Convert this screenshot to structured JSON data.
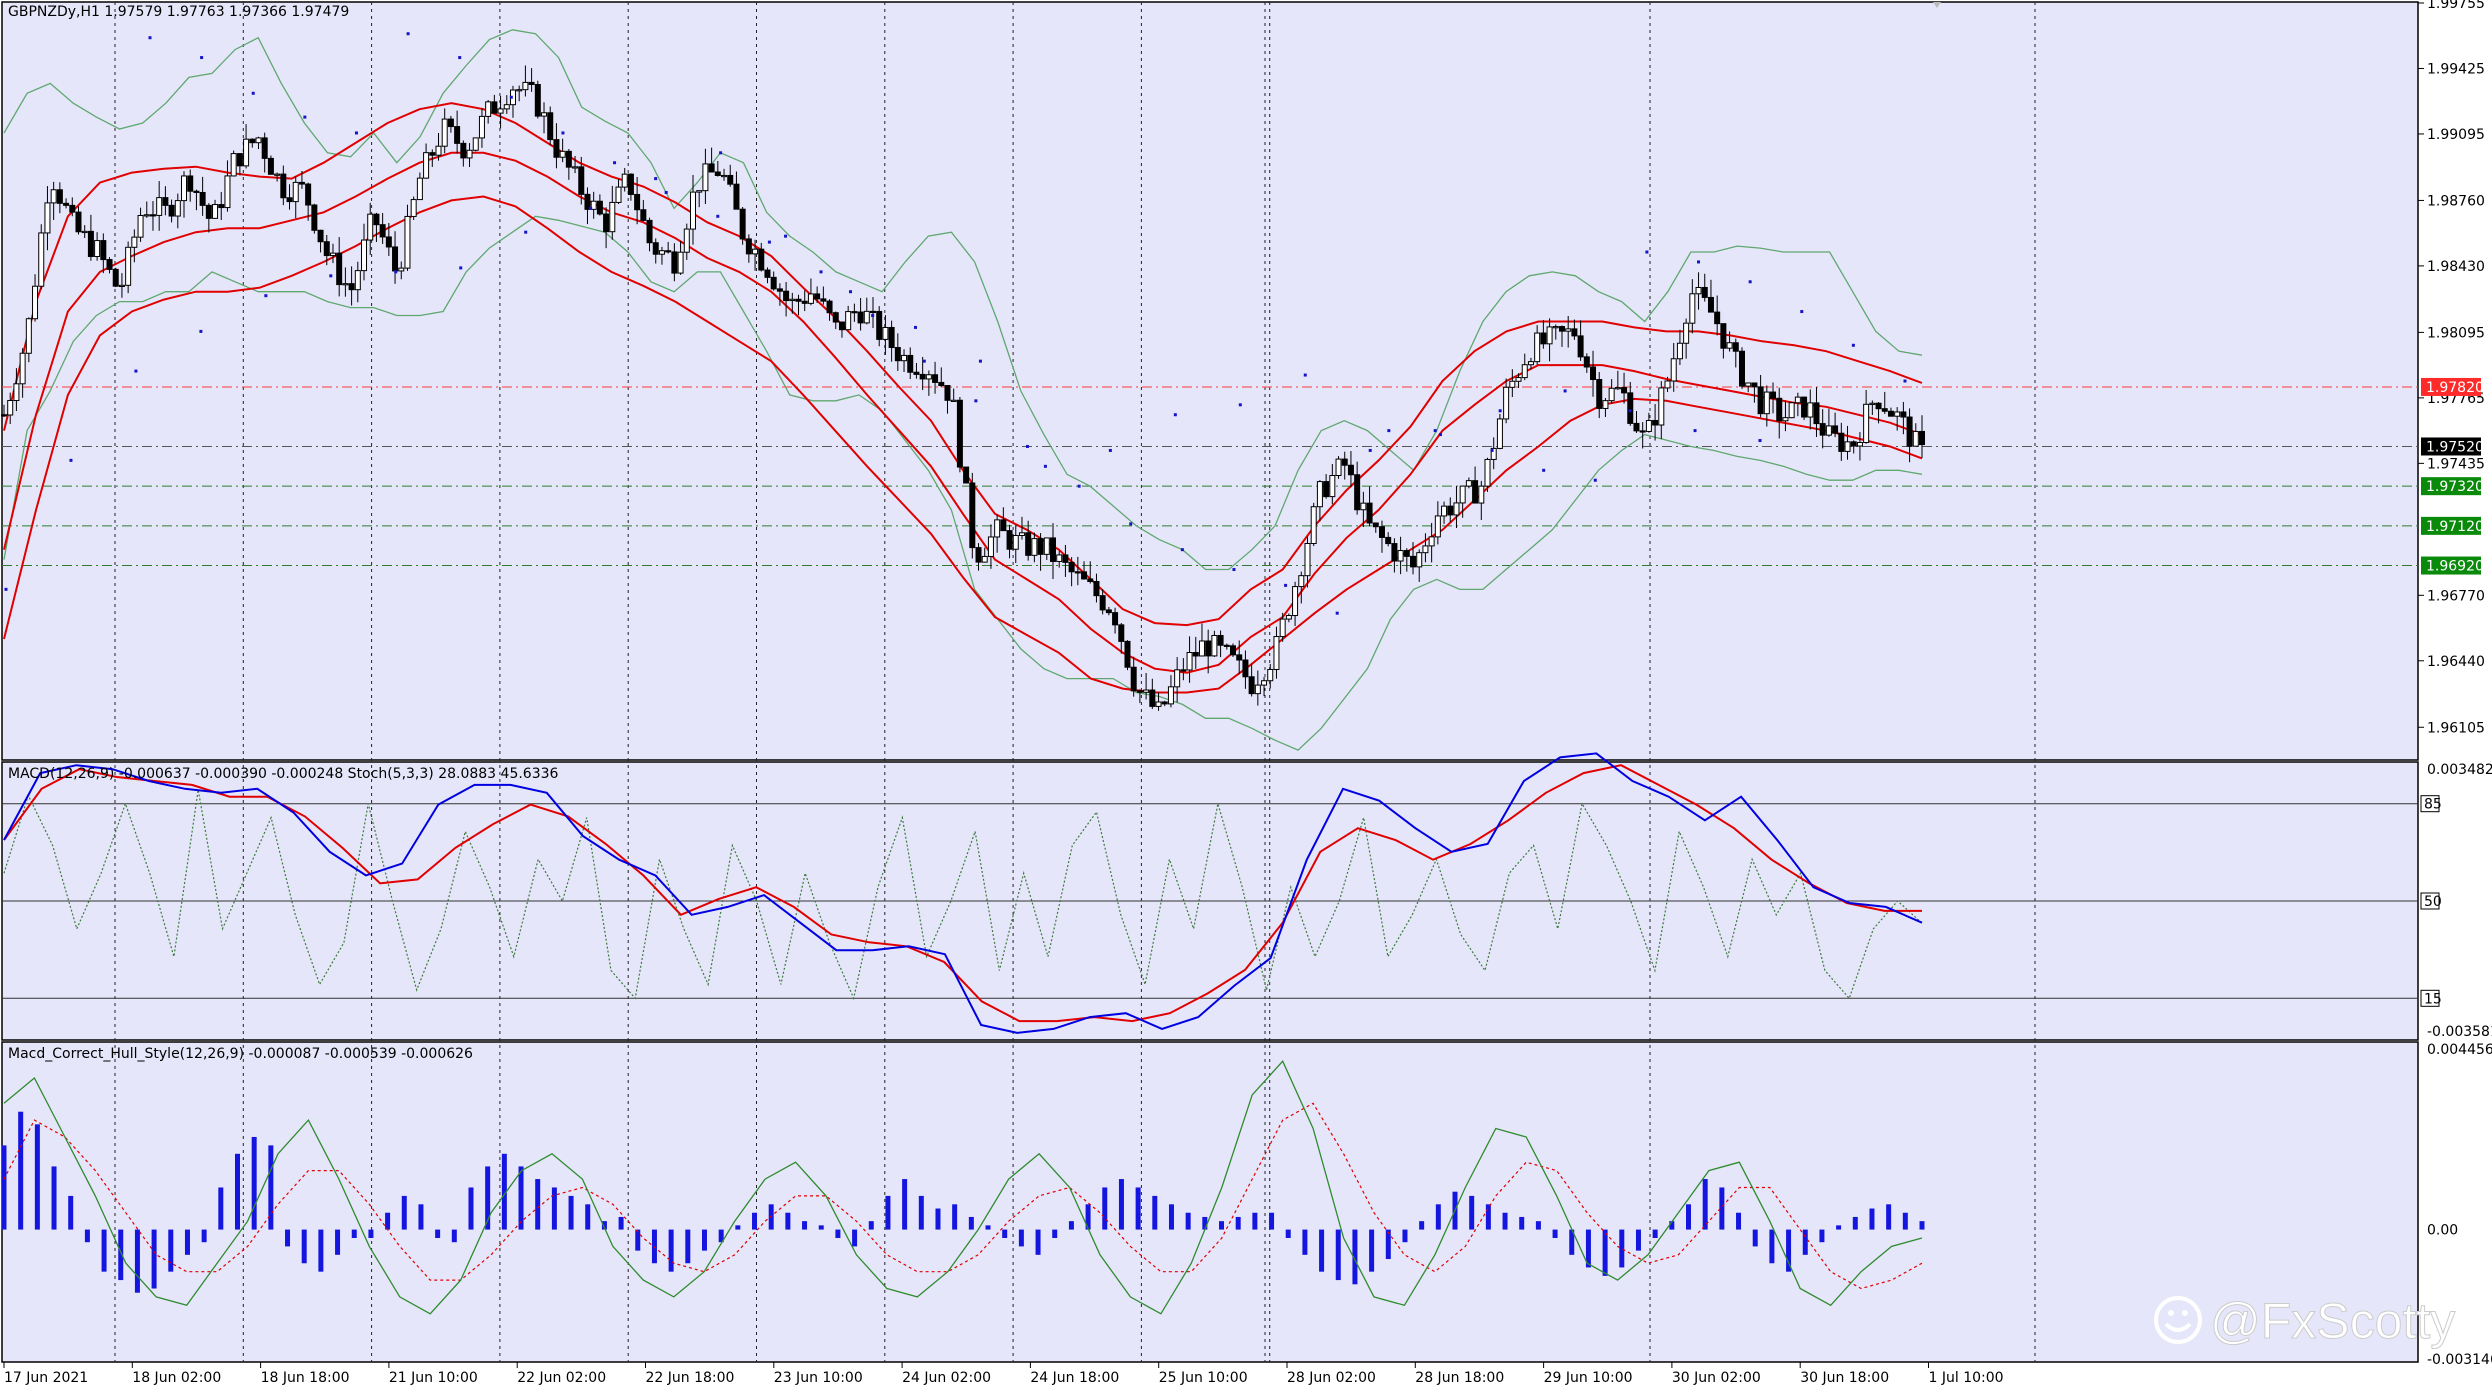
{
  "window": {
    "symbol_header": "GBPNZDy,H1  1.97579 1.97763 1.97366 1.97479",
    "watermark": "@FxScotty"
  },
  "colors": {
    "background": "#e6e6fa",
    "bull_candle": "#ffffff",
    "bear_candle": "#000000",
    "bollinger": "#5fa86f",
    "envelope": "#e00000",
    "parabolic_sar": "#1515c8",
    "macd_line": "#0000e0",
    "signal_line": "#e00000",
    "stoch": "#3b7a3b",
    "histogram": "#1515e0",
    "hull_line": "#2e8b2e",
    "hull_signal": "#e00000"
  },
  "chart_data": [
    {
      "type": "line",
      "title": "GBPNZDy,H1  1.97579 1.97763 1.97366 1.97479",
      "ylim": [
        1.9594,
        1.9976
      ],
      "y_ticks": [
        "1.99755",
        "1.99425",
        "1.99095",
        "1.98760",
        "1.98430",
        "1.98095",
        "1.97765",
        "1.97435",
        "1.96770",
        "1.96440",
        "1.96105"
      ],
      "price_labels": [
        {
          "text": "1.97820",
          "value": 1.9782,
          "bg": "#ff2b2b",
          "fg": "#ffffff",
          "line": "#ff3b3b"
        },
        {
          "text": "1.97520",
          "value": 1.9752,
          "bg": "#000000",
          "fg": "#ffffff",
          "line": "#555555"
        },
        {
          "text": "1.97320",
          "value": 1.9732,
          "bg": "#0a8a0a",
          "fg": "#ffffff",
          "line": "#2e7d2e"
        },
        {
          "text": "1.97120",
          "value": 1.9712,
          "bg": "#0a8a0a",
          "fg": "#ffffff",
          "line": "#2e7d2e"
        },
        {
          "text": "1.96920",
          "value": 1.9692,
          "bg": "#0a8a0a",
          "fg": "#ffffff",
          "line": "#2e7d2e"
        }
      ],
      "price_path": [
        1.9768,
        1.9808,
        1.9891,
        1.9862,
        1.9851,
        1.983,
        1.9873,
        1.987,
        1.9889,
        1.9864,
        1.9897,
        1.9908,
        1.9883,
        1.9881,
        1.9848,
        1.983,
        1.9868,
        1.9839,
        1.9887,
        1.9912,
        1.9902,
        1.9921,
        1.9934,
        1.9927,
        1.99,
        1.9881,
        1.9864,
        1.9887,
        1.9853,
        1.9846,
        1.9885,
        1.9892,
        1.9859,
        1.9843,
        1.9823,
        1.983,
        1.9811,
        1.9822,
        1.9808,
        1.9796,
        1.9792,
        1.9778,
        1.9697,
        1.9709,
        1.9702,
        1.9701,
        1.969,
        1.968,
        1.967,
        1.963,
        1.9617,
        1.9641,
        1.9653,
        1.9645,
        1.9633,
        1.9648,
        1.9688,
        1.973,
        1.9743,
        1.9712,
        1.9701,
        1.9691,
        1.9718,
        1.9725,
        1.9733,
        1.9778,
        1.9801,
        1.9806,
        1.981,
        1.9778,
        1.978,
        1.9754,
        1.9786,
        1.983,
        1.9818,
        1.9792,
        1.9775,
        1.9767,
        1.9773,
        1.9756,
        1.9753,
        1.9778,
        1.9766,
        1.9748
      ],
      "bollinger_upper": [
        1.991,
        1.993,
        1.9935,
        1.9925,
        1.9918,
        1.9912,
        1.9915,
        1.9925,
        1.9938,
        1.994,
        1.9952,
        1.9958,
        1.9935,
        1.9915,
        1.99,
        1.9898,
        1.991,
        1.9895,
        1.9908,
        1.993,
        1.9944,
        1.9957,
        1.9962,
        1.996,
        1.9948,
        1.9923,
        1.9916,
        1.991,
        1.9895,
        1.9872,
        1.9885,
        1.99,
        1.9895,
        1.987,
        1.9858,
        1.985,
        1.984,
        1.9835,
        1.983,
        1.9845,
        1.9858,
        1.986,
        1.9845,
        1.9815,
        1.978,
        1.9758,
        1.9738,
        1.9732,
        1.9722,
        1.9712,
        1.9705,
        1.97,
        1.969,
        1.969,
        1.97,
        1.9712,
        1.974,
        1.976,
        1.9765,
        1.976,
        1.975,
        1.974,
        1.976,
        1.979,
        1.9815,
        1.983,
        1.9838,
        1.984,
        1.9838,
        1.983,
        1.9825,
        1.9815,
        1.983,
        1.985,
        1.985,
        1.9853,
        1.9852,
        1.985,
        1.985,
        1.985,
        1.983,
        1.981,
        1.98,
        1.9798
      ],
      "bollinger_lower": [
        1.9695,
        1.976,
        1.978,
        1.9805,
        1.9818,
        1.9825,
        1.9825,
        1.983,
        1.983,
        1.984,
        1.9835,
        1.983,
        1.983,
        1.983,
        1.9825,
        1.9822,
        1.9822,
        1.9818,
        1.9818,
        1.982,
        1.984,
        1.9852,
        1.986,
        1.9868,
        1.9866,
        1.9863,
        1.986,
        1.985,
        1.9835,
        1.983,
        1.984,
        1.984,
        1.982,
        1.98,
        1.9778,
        1.9775,
        1.9775,
        1.9778,
        1.977,
        1.9755,
        1.974,
        1.972,
        1.968,
        1.9665,
        1.965,
        1.964,
        1.9635,
        1.9635,
        1.9635,
        1.9628,
        1.9626,
        1.9622,
        1.9615,
        1.9615,
        1.961,
        1.9604,
        1.9599,
        1.961,
        1.9625,
        1.964,
        1.9665,
        1.968,
        1.9685,
        1.968,
        1.968,
        1.969,
        1.97,
        1.971,
        1.9725,
        1.974,
        1.975,
        1.9758,
        1.9755,
        1.9752,
        1.975,
        1.9747,
        1.9745,
        1.9742,
        1.9738,
        1.9735,
        1.9735,
        1.974,
        1.974,
        1.9738
      ],
      "envelope_upper": [
        1.976,
        1.9825,
        1.9868,
        1.9885,
        1.989,
        1.9892,
        1.9893,
        1.989,
        1.9888,
        1.9887,
        1.9895,
        1.9905,
        1.9915,
        1.9922,
        1.9925,
        1.9922,
        1.9915,
        1.9905,
        1.9895,
        1.9888,
        1.9883,
        1.9875,
        1.9865,
        1.9858,
        1.9848,
        1.9832,
        1.9817,
        1.98,
        1.9782,
        1.9765,
        1.974,
        1.9718,
        1.971,
        1.97,
        1.9685,
        1.967,
        1.9663,
        1.9662,
        1.9665,
        1.968,
        1.969,
        1.9712,
        1.973,
        1.9745,
        1.9762,
        1.9785,
        1.98,
        1.981,
        1.9815,
        1.9815,
        1.9815,
        1.9812,
        1.981,
        1.981,
        1.9808,
        1.9805,
        1.9803,
        1.98,
        1.9795,
        1.979,
        1.9784
      ],
      "envelope_mid": [
        1.97,
        1.9768,
        1.982,
        1.984,
        1.9848,
        1.9855,
        1.986,
        1.9862,
        1.9862,
        1.9866,
        1.987,
        1.9878,
        1.9887,
        1.9895,
        1.99,
        1.99,
        1.9896,
        1.9888,
        1.9878,
        1.987,
        1.9865,
        1.9857,
        1.9847,
        1.984,
        1.983,
        1.9815,
        1.9797,
        1.9778,
        1.976,
        1.9742,
        1.9718,
        1.9695,
        1.9685,
        1.9675,
        1.966,
        1.9648,
        1.964,
        1.9638,
        1.9642,
        1.9656,
        1.9666,
        1.9688,
        1.9706,
        1.972,
        1.9738,
        1.976,
        1.9773,
        1.9785,
        1.9793,
        1.9793,
        1.9793,
        1.979,
        1.9786,
        1.9783,
        1.978,
        1.9777,
        1.9774,
        1.9772,
        1.9768,
        1.9764,
        1.9758
      ],
      "envelope_lower": [
        1.9655,
        1.972,
        1.9778,
        1.9808,
        1.982,
        1.9826,
        1.983,
        1.983,
        1.9832,
        1.9838,
        1.9845,
        1.9853,
        1.9862,
        1.987,
        1.9876,
        1.9878,
        1.9873,
        1.9862,
        1.985,
        1.984,
        1.9833,
        1.9825,
        1.9815,
        1.9805,
        1.9795,
        1.9778,
        1.976,
        1.9742,
        1.9725,
        1.9708,
        1.9686,
        1.9666,
        1.9657,
        1.9648,
        1.9635,
        1.963,
        1.9628,
        1.9628,
        1.963,
        1.9642,
        1.9655,
        1.9668,
        1.968,
        1.969,
        1.97,
        1.971,
        1.9725,
        1.974,
        1.9752,
        1.9765,
        1.9773,
        1.9776,
        1.9775,
        1.9772,
        1.9769,
        1.9766,
        1.9763,
        1.976,
        1.9756,
        1.9752,
        1.9746
      ],
      "sar_below": [
        1.968,
        1.9745,
        1.979,
        1.981,
        1.9828,
        1.9838,
        1.984,
        1.9842,
        1.986,
        1.9872,
        1.9887,
        1.99,
        1.9858,
        1.983,
        1.9812,
        1.9795,
        1.9742,
        1.975,
        1.9768,
        1.9773,
        1.9788,
        1.975,
        1.976,
        1.977,
        1.978,
        1.977,
        1.976,
        1.9755
      ],
      "sar_above": [
        1.9958,
        1.9948,
        1.993,
        1.9918,
        1.991,
        1.996,
        1.9948,
        1.9928,
        1.991,
        1.9895,
        1.988,
        1.9868,
        1.9855,
        1.984,
        1.9818,
        1.9795,
        1.9775,
        1.9752,
        1.9732,
        1.9713,
        1.97,
        1.969,
        1.9682,
        1.9668,
        1.976,
        1.9758,
        1.975,
        1.974,
        1.9735,
        1.985,
        1.9845,
        1.9835,
        1.982,
        1.9803,
        1.9785
      ]
    },
    {
      "type": "line",
      "title": "MACD(12,26,9) -0.000637 -0.000390 -0.000248  Stoch(5,3,3) 28.0883 45.6336",
      "ylim": [
        -0.003581,
        0.003482
      ],
      "y_ticks": [
        "0.003482",
        "-0.003581"
      ],
      "levels": [
        {
          "text": "85",
          "value": 85
        },
        {
          "text": "50",
          "value": 50
        },
        {
          "text": "15",
          "value": 15
        }
      ],
      "series": [
        {
          "name": "MACD",
          "values": [
            0.0015,
            0.0032,
            0.0034,
            0.0033,
            0.003,
            0.0028,
            0.0027,
            0.0028,
            0.0022,
            0.0012,
            0.0006,
            0.0009,
            0.0024,
            0.0029,
            0.0029,
            0.0027,
            0.0016,
            0.001,
            0.0006,
            -0.0004,
            -0.0002,
            0.0001,
            -0.0006,
            -0.0013,
            -0.0013,
            -0.0012,
            -0.0014,
            -0.0032,
            -0.0034,
            -0.0033,
            -0.003,
            -0.0029,
            -0.0033,
            -0.003,
            -0.0022,
            -0.0015,
            0.001,
            0.0028,
            0.0025,
            0.0018,
            0.0012,
            0.0014,
            0.003,
            0.0036,
            0.0037,
            0.003,
            0.0026,
            0.002,
            0.0026,
            0.0015,
            0.0003,
            -0.0001,
            -0.0002,
            -0.0006
          ]
        },
        {
          "name": "Signal",
          "values": [
            0.0015,
            0.0028,
            0.0033,
            0.0031,
            0.003,
            0.0029,
            0.0026,
            0.0026,
            0.0021,
            0.0013,
            0.0004,
            0.0005,
            0.0013,
            0.0019,
            0.0024,
            0.0021,
            0.0014,
            0.0006,
            -0.0004,
            0.0,
            0.0003,
            -0.0002,
            -0.0009,
            -0.0011,
            -0.0012,
            -0.0016,
            -0.0026,
            -0.0031,
            -0.0031,
            -0.003,
            -0.0031,
            -0.0029,
            -0.0024,
            -0.0018,
            -0.0006,
            0.0012,
            0.0018,
            0.0015,
            0.001,
            0.0014,
            0.002,
            0.0027,
            0.0032,
            0.0034,
            0.0029,
            0.0024,
            0.0018,
            0.001,
            0.0004,
            -0.0001,
            -0.0003,
            -0.0003
          ]
        },
        {
          "name": "Stoch",
          "values": [
            60,
            88,
            70,
            40,
            60,
            85,
            60,
            30,
            90,
            40,
            60,
            80,
            45,
            20,
            35,
            85,
            50,
            18,
            40,
            75,
            55,
            30,
            65,
            50,
            80,
            25,
            15,
            65,
            40,
            20,
            70,
            50,
            20,
            60,
            35,
            15,
            55,
            80,
            30,
            50,
            75,
            25,
            60,
            30,
            70,
            82,
            45,
            20,
            65,
            40,
            85,
            55,
            18,
            55,
            30,
            50,
            80,
            30,
            45,
            65,
            38,
            25,
            60,
            70,
            40,
            85,
            70,
            50,
            25,
            75,
            55,
            30,
            65,
            45,
            60,
            25,
            15,
            40,
            50,
            42
          ]
        }
      ]
    },
    {
      "type": "bar",
      "title": "Macd_Correct_Hull_Style(12,26,9) -0.000087 -0.000539 -0.000626",
      "ylim": [
        -0.003146,
        0.004456
      ],
      "y_ticks": [
        "0.004456",
        "0.00",
        "-0.003146"
      ],
      "values": [
        0.002,
        0.0028,
        0.0025,
        0.0015,
        0.0008,
        -0.0003,
        -0.001,
        -0.0012,
        -0.0015,
        -0.0014,
        -0.001,
        -0.0006,
        -0.0003,
        0.001,
        0.0018,
        0.0022,
        0.002,
        -0.0004,
        -0.0008,
        -0.001,
        -0.0006,
        -0.0002,
        -0.0002,
        0.0004,
        0.0008,
        0.0006,
        -0.0002,
        -0.0003,
        0.001,
        0.0015,
        0.0018,
        0.0015,
        0.0012,
        0.001,
        0.0008,
        0.0006,
        0.0002,
        0.0003,
        -0.0005,
        -0.0008,
        -0.001,
        -0.0008,
        -0.0005,
        -0.0003,
        0.0001,
        0.0004,
        0.0006,
        0.0004,
        0.0002,
        0.0001,
        -0.0002,
        -0.0004,
        0.0002,
        0.0008,
        0.0012,
        0.0008,
        0.0005,
        0.0006,
        0.0003,
        0.0001,
        -0.0002,
        -0.0004,
        -0.0006,
        -0.0002,
        0.0002,
        0.0006,
        0.001,
        0.0012,
        0.001,
        0.0008,
        0.0006,
        0.0004,
        0.0003,
        0.0002,
        0.0003,
        0.0004,
        0.0004,
        -0.0002,
        -0.0006,
        -0.001,
        -0.0012,
        -0.0013,
        -0.001,
        -0.0007,
        -0.0003,
        0.0002,
        0.0006,
        0.0009,
        0.0008,
        0.0006,
        0.0004,
        0.0003,
        0.0002,
        -0.0002,
        -0.0006,
        -0.0009,
        -0.0011,
        -0.0009,
        -0.0005,
        -0.0002,
        0.0002,
        0.0006,
        0.0012,
        0.001,
        0.0004,
        -0.0004,
        -0.0008,
        -0.001,
        -0.0006,
        -0.0003,
        0.0001,
        0.0003,
        0.0005,
        0.0006,
        0.0004,
        0.0002
      ],
      "series": [
        {
          "name": "Hull",
          "values": [
            0.003,
            0.0036,
            0.0022,
            0.0008,
            -0.0008,
            -0.0016,
            -0.0018,
            -0.0008,
            0.0002,
            0.0018,
            0.0026,
            0.0012,
            -0.0004,
            -0.0016,
            -0.002,
            -0.0012,
            0.0004,
            0.0014,
            0.0018,
            0.0012,
            -0.0004,
            -0.0012,
            -0.0016,
            -0.001,
            0.0002,
            0.0012,
            0.0016,
            0.0008,
            -0.0006,
            -0.0014,
            -0.0016,
            -0.001,
            0.0,
            0.0012,
            0.0018,
            0.001,
            -0.0006,
            -0.0016,
            -0.002,
            -0.0008,
            0.001,
            0.0032,
            0.004,
            0.0024,
            -0.0002,
            -0.0016,
            -0.0018,
            -0.0006,
            0.001,
            0.0024,
            0.0022,
            0.0008,
            -0.0008,
            -0.0012,
            -0.0006,
            0.0004,
            0.0014,
            0.0016,
            0.0002,
            -0.0014,
            -0.0018,
            -0.001,
            -0.0004,
            -0.0002
          ]
        },
        {
          "name": "Signal",
          "values": [
            0.0012,
            0.0026,
            0.0022,
            0.0014,
            0.0004,
            -0.0006,
            -0.001,
            -0.001,
            -0.0004,
            0.0006,
            0.0014,
            0.0014,
            0.0006,
            -0.0004,
            -0.0012,
            -0.0012,
            -0.0006,
            0.0002,
            0.0008,
            0.001,
            0.0006,
            -0.0002,
            -0.0008,
            -0.001,
            -0.0006,
            0.0002,
            0.0008,
            0.0008,
            0.0002,
            -0.0006,
            -0.001,
            -0.001,
            -0.0006,
            0.0002,
            0.0008,
            0.001,
            0.0004,
            -0.0004,
            -0.001,
            -0.001,
            -0.0002,
            0.0012,
            0.0026,
            0.003,
            0.0018,
            0.0004,
            -0.0006,
            -0.001,
            -0.0004,
            0.0008,
            0.0016,
            0.0014,
            0.0004,
            -0.0004,
            -0.0008,
            -0.0006,
            0.0002,
            0.001,
            0.001,
            0.0,
            -0.001,
            -0.0014,
            -0.0012,
            -0.0008
          ]
        }
      ]
    }
  ],
  "time_axis": [
    "17 Jun 2021",
    "18 Jun 02:00",
    "18 Jun 18:00",
    "21 Jun 10:00",
    "22 Jun 02:00",
    "22 Jun 18:00",
    "23 Jun 10:00",
    "24 Jun 02:00",
    "24 Jun 18:00",
    "25 Jun 10:00",
    "28 Jun 02:00",
    "28 Jun 18:00",
    "29 Jun 10:00",
    "30 Jun 02:00",
    "30 Jun 18:00",
    "1 Jul 10:00"
  ]
}
